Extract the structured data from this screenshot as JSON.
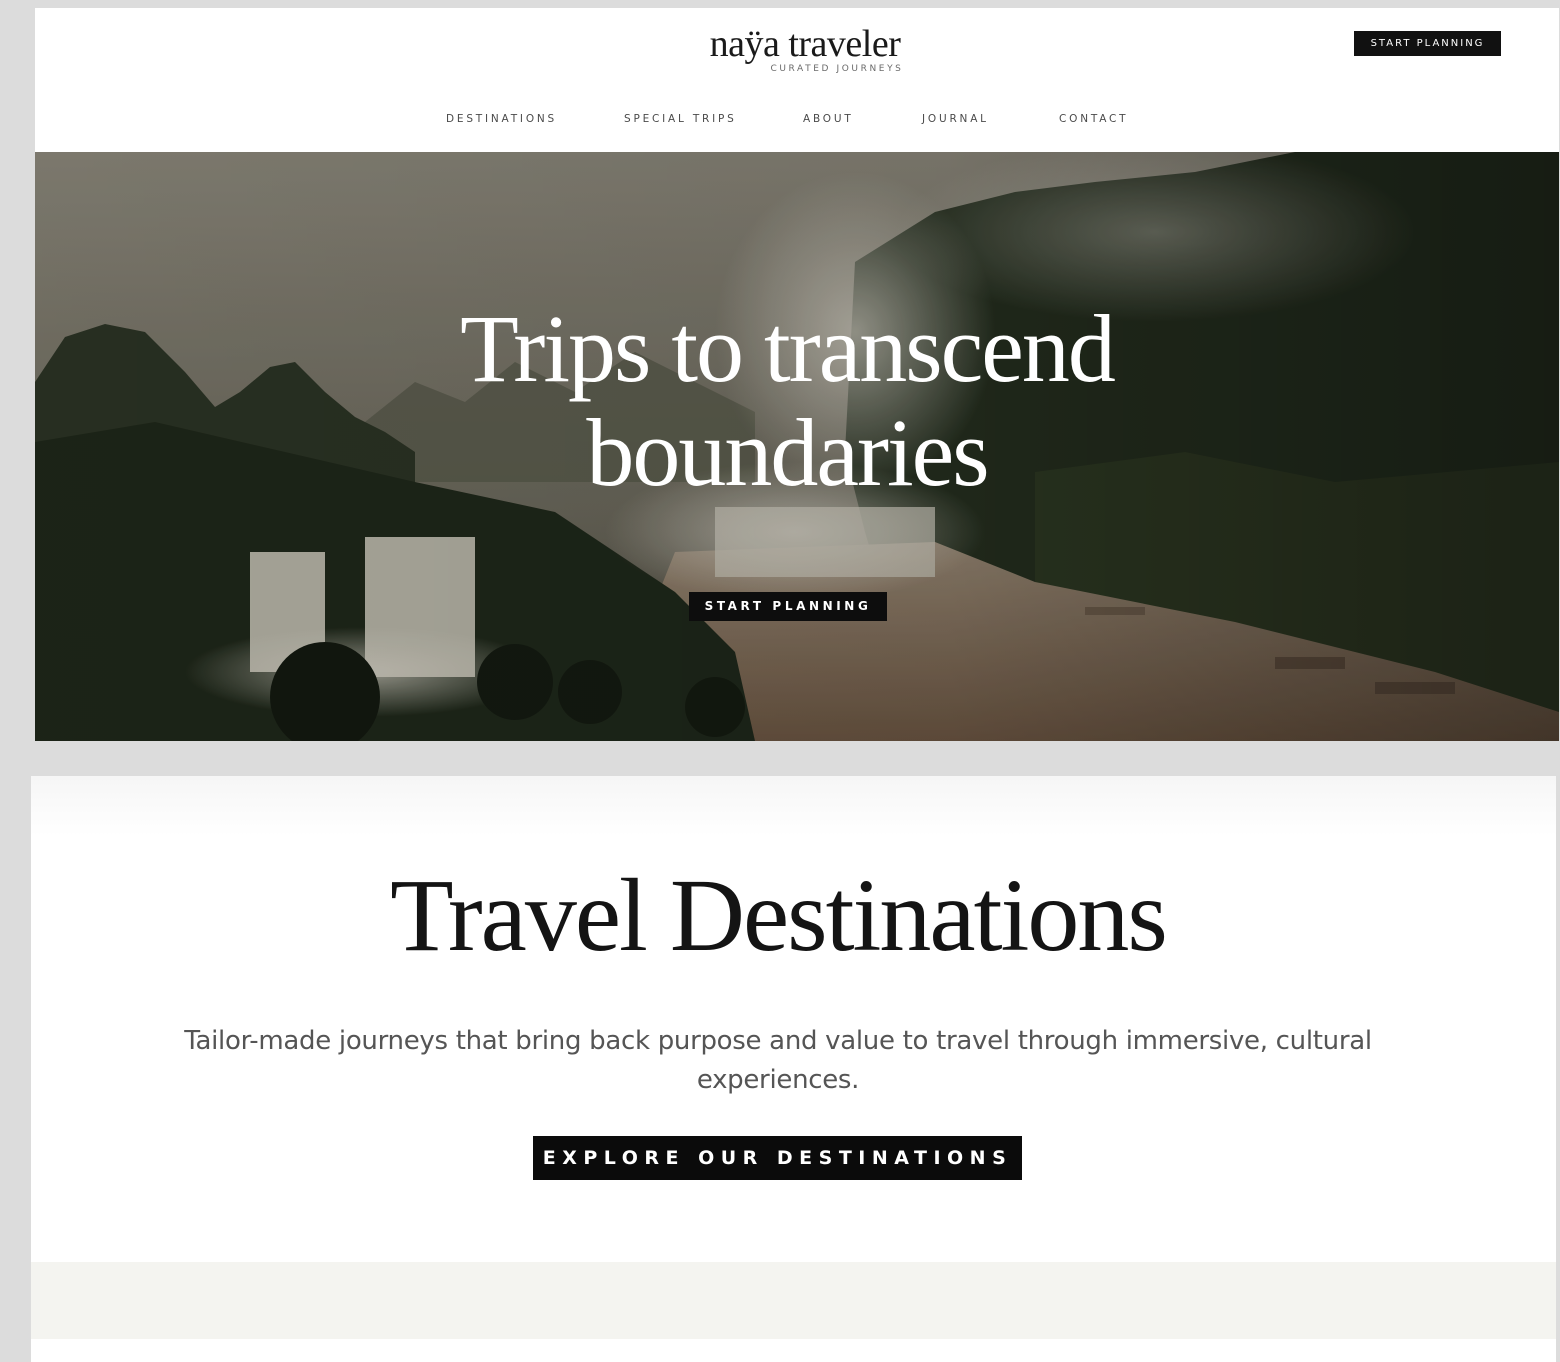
{
  "header": {
    "logo_name": "naÿa traveler",
    "logo_tagline": "CURATED JOURNEYS",
    "cta_label": "START PLANNING"
  },
  "nav": {
    "items": [
      {
        "label": "DESTINATIONS"
      },
      {
        "label": "SPECIAL TRIPS"
      },
      {
        "label": "ABOUT"
      },
      {
        "label": "JOURNAL"
      },
      {
        "label": "CONTACT"
      }
    ]
  },
  "hero": {
    "title_line1": "Trips to transcend",
    "title_line2": "boundaries",
    "cta_label": "START PLANNING"
  },
  "destinations": {
    "title": "Travel Destinations",
    "description": "Tailor-made journeys that bring back purpose and value to travel through immersive, cultural experiences.",
    "cta_label": "EXPLORE OUR DESTINATIONS"
  },
  "colors": {
    "page_background": "#dcdcdc",
    "button_black": "#111111",
    "band_cream": "#f4f4f0"
  }
}
